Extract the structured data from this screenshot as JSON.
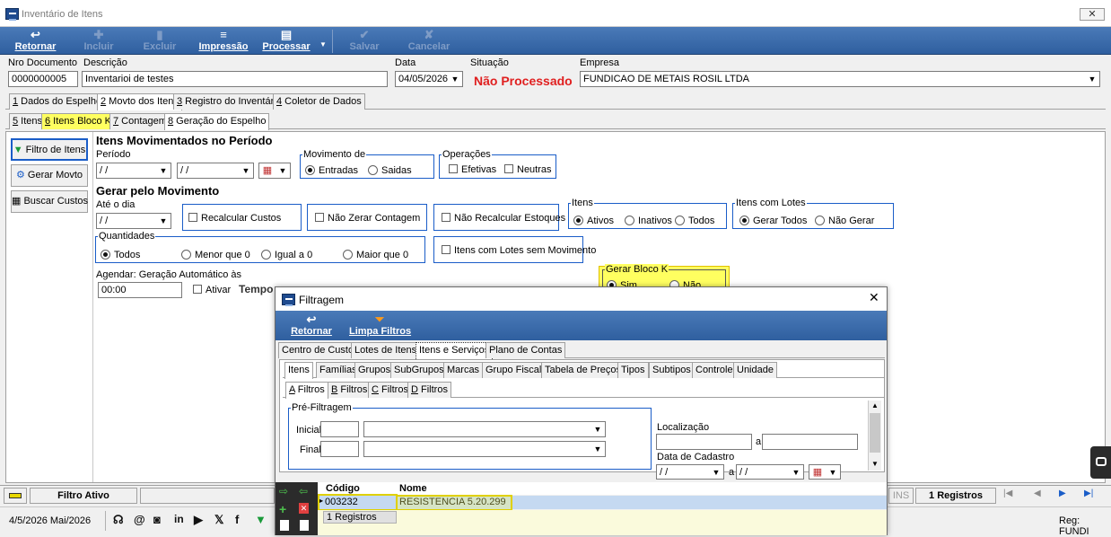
{
  "window": {
    "title": "Inventário de Itens",
    "close_glyph": "✕"
  },
  "toolbar": {
    "retornar": "Retornar",
    "incluir": "Incluir",
    "excluir": "Excluir",
    "impressao": "Impressão",
    "processar": "Processar",
    "salvar": "Salvar",
    "cancelar": "Cancelar"
  },
  "header": {
    "nro_label": "Nro Documento",
    "nro_value": "0000000005",
    "desc_label": "Descrição",
    "desc_value": "Inventarioi de testes",
    "data_label": "Data",
    "data_value": "04/05/2026",
    "situacao_label": "Situação",
    "situacao_value": "Não Processado",
    "empresa_label": "Empresa",
    "empresa_value": "FUNDICAO DE METAIS ROSIL LTDA"
  },
  "tabs_main": [
    {
      "num": "1",
      "label": " Dados do Espelho"
    },
    {
      "num": "2",
      "label": " Movto dos Itens"
    },
    {
      "num": "3",
      "label": " Registro do Inventário"
    },
    {
      "num": "4",
      "label": " Coletor de Dados"
    }
  ],
  "tabs_sub": [
    {
      "num": "5",
      "label": " Itens"
    },
    {
      "num": "6",
      "label": " Itens Bloco K"
    },
    {
      "num": "7",
      "label": " Contagem"
    },
    {
      "num": "8",
      "label": " Geração do Espelho"
    }
  ],
  "side": {
    "filtro": "Filtro de Itens",
    "gerar": "Gerar Movto",
    "buscar": "Buscar Custos"
  },
  "form": {
    "h_itens": "Itens Movimentados no Período",
    "periodo_label": "Período",
    "date_empty": "/ /",
    "mov_title": "Movimento de",
    "mov_entradas": "Entradas",
    "mov_saidas": "Saidas",
    "op_title": "Operações",
    "op_efetivas": "Efetivas",
    "op_neutras": "Neutras",
    "h_gerar": "Gerar pelo Movimento",
    "ate_label": "Até o dia",
    "recalc": "Recalcular Custos",
    "nao_zerar": "Não Zerar Contagem",
    "nao_recalc": "Não Recalcular Estoques",
    "itens_title": "Itens",
    "itens_ativos": "Ativos",
    "itens_inativos": "Inativos",
    "itens_todos": "Todos",
    "lotes_title": "Itens com Lotes",
    "lotes_gerar": "Gerar Todos",
    "lotes_nao": "Não Gerar",
    "qtd_title": "Quantidades",
    "qtd_todos": "Todos",
    "qtd_menor": "Menor que 0",
    "qtd_igual": "Igual a 0",
    "qtd_maior": "Maior que 0",
    "lotes_sem_mov": "Itens com Lotes sem Movimento",
    "agendar_label": "Agendar: Geração Automático às",
    "agendar_time": "00:00",
    "ativar": "Ativar",
    "tempo": "Tempo",
    "bloco_k_title": "Gerar Bloco K",
    "bloco_sim": "Sim",
    "bloco_nao": "Não"
  },
  "status": {
    "filtro_ativo": "Filtro Ativo",
    "ins": "INS",
    "registros": "1 Registros"
  },
  "bottom": {
    "date": "4/5/2026 Mai/2026",
    "reg": "Reg: FUNDI"
  },
  "dialog": {
    "title": "Filtragem",
    "close_glyph": "✕",
    "retornar": "Retornar",
    "limpa": "Limpa Filtros",
    "tabs1": [
      "Centro de Custo",
      "Lotes de Itens",
      "Itens e Serviços",
      "Plano de Contas"
    ],
    "tabs2": [
      "Itens",
      "Famílias",
      "Grupos",
      "SubGrupos",
      "Marcas",
      "Grupo Fiscal",
      "Tabela de Preços",
      "Tipos",
      "Subtipos",
      "Controle",
      "Unidade"
    ],
    "tabs3": [
      {
        "u": "A",
        "rest": " Filtros"
      },
      {
        "u": "B",
        "rest": " Filtros"
      },
      {
        "u": "C",
        "rest": " Filtros"
      },
      {
        "u": "D",
        "rest": " Filtros"
      }
    ],
    "prefilt": "Pré-Filtragem",
    "inicial": "Inicial",
    "final": "Final",
    "localizacao": "Localização",
    "a": "a",
    "data_cadastro": "Data de Cadastro",
    "date_empty": "/ /",
    "grid_headers": {
      "codigo": "Código",
      "nome": "Nome"
    },
    "grid_row": {
      "codigo": "003232",
      "nome": "RESISTENCIA 5.20.299"
    },
    "grid_count": "1 Registros"
  }
}
